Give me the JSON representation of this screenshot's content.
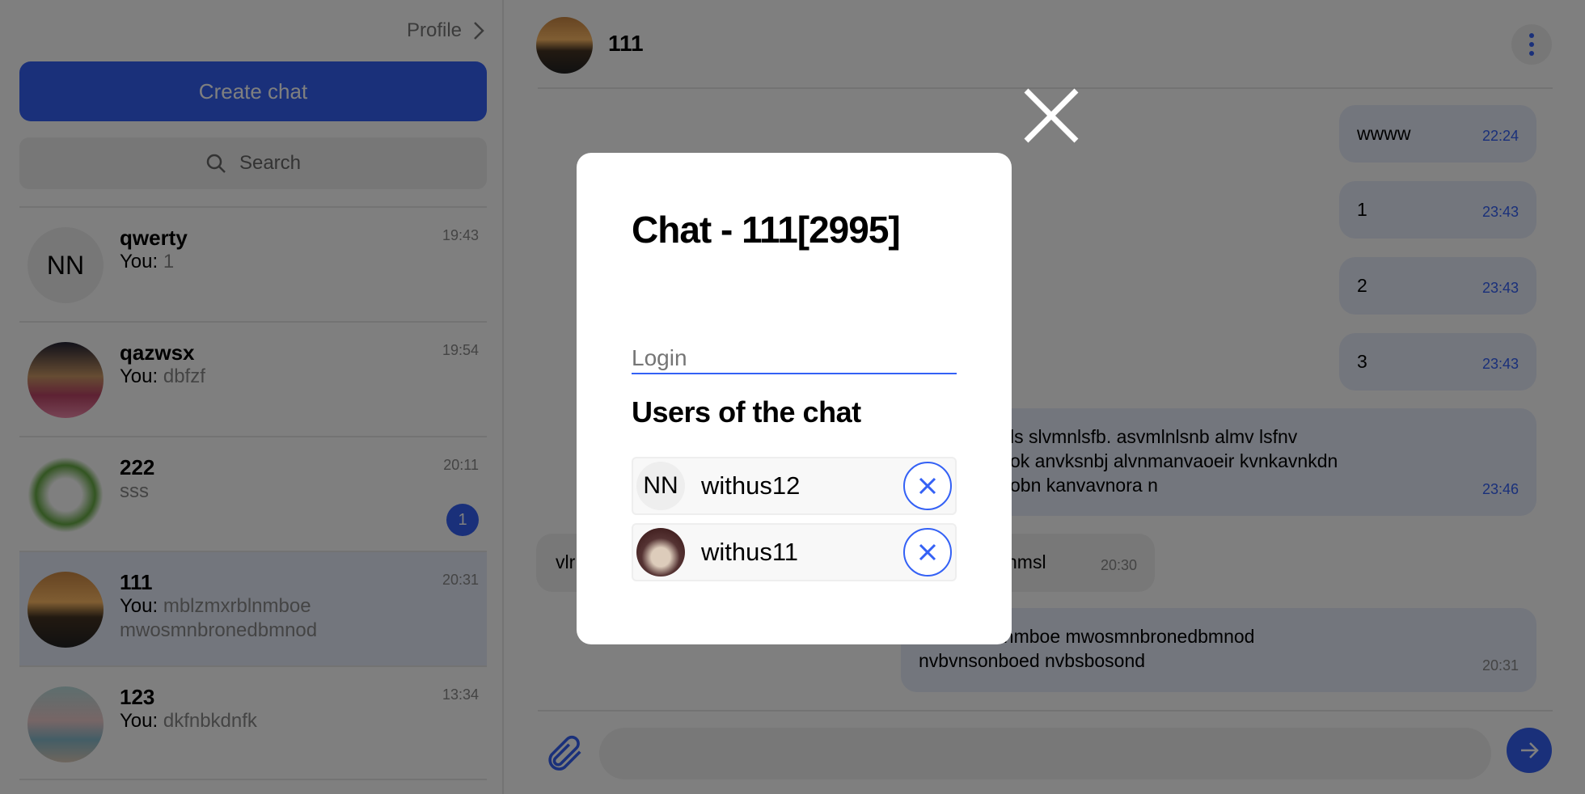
{
  "sidebar": {
    "profile_label": "Profile",
    "create_chat_label": "Create chat",
    "search_placeholder": "Search",
    "chats": [
      {
        "name": "qwerty",
        "prefix": "You:",
        "preview": "1",
        "time": "19:43",
        "avatar": "NN"
      },
      {
        "name": "qazwsx",
        "prefix": "You:",
        "preview": "dbfzf",
        "time": "19:54"
      },
      {
        "name": "222",
        "prefix": "",
        "preview": "sss",
        "time": "20:11",
        "unread": "1"
      },
      {
        "name": "111",
        "prefix": "You:",
        "preview": "mblzmxrblnmboe mwosmnbronedbmnod",
        "time": "20:31",
        "active": true
      },
      {
        "name": "123",
        "prefix": "You:",
        "preview": "dkfnbkdnfk",
        "time": "13:34"
      }
    ]
  },
  "chat": {
    "title": "111",
    "messages": [
      {
        "text": "wwww",
        "time": "22:24",
        "out": true
      },
      {
        "text": "1",
        "time": "23:43",
        "out": true
      },
      {
        "text": "2",
        "time": "23:43",
        "out": true
      },
      {
        "text": "3",
        "time": "23:43",
        "out": true
      },
      {
        "lines": [
          "ls slvmnlsfb. asvmlnlsnb almv lsfnv",
          "ok anvksnbj alvnmanvaoeir kvnkavnkdn",
          "obn kanvavnora n"
        ],
        "time": "23:46",
        "out": true
      },
      {
        "text_start": "vlr",
        "text_end": "nmsl",
        "time": "20:30",
        "out": false
      },
      {
        "lines": [
          "mblzmxrblnmboe mwosmnbronedbmnod",
          "nvbvnsonboed nvbsbosond"
        ],
        "time": "20:31",
        "out": false
      }
    ],
    "message_input_placeholder": ""
  },
  "modal": {
    "title": "Chat - 111[2995]",
    "login_placeholder": "Login",
    "users_heading": "Users of the chat",
    "users": [
      {
        "name": "withus12",
        "avatar": "NN"
      },
      {
        "name": "withus11"
      }
    ]
  },
  "colors": {
    "accent": "#3461f5",
    "bubble": "#e6ecfb"
  }
}
